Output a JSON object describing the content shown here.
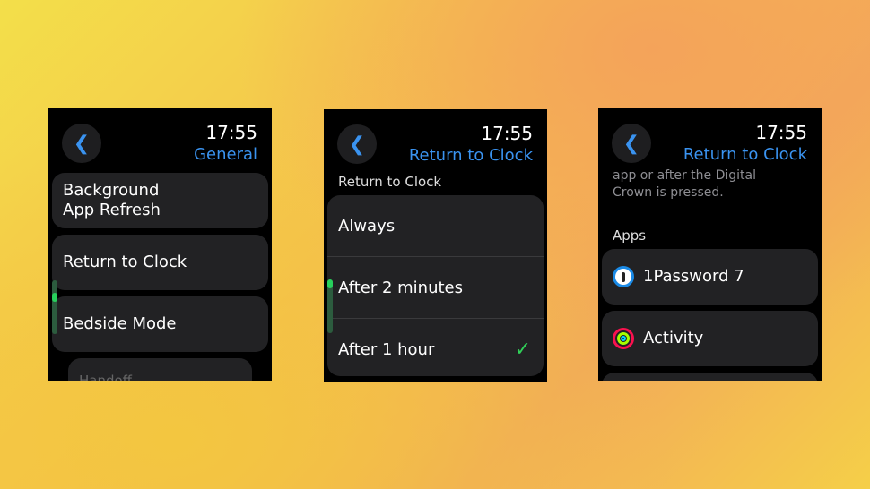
{
  "screens": [
    {
      "time": "17:55",
      "title": "General",
      "items": [
        "Background\nApp Refresh",
        "Return to Clock",
        "Bedside Mode",
        "Handoff"
      ]
    },
    {
      "time": "17:55",
      "title": "Return to Clock",
      "section": "Return to Clock",
      "options": [
        {
          "label": "Always",
          "selected": false
        },
        {
          "label": "After 2 minutes",
          "selected": false
        },
        {
          "label": "After 1 hour",
          "selected": true
        }
      ],
      "check_color": "#30d158"
    },
    {
      "time": "17:55",
      "title": "Return to Clock",
      "description": "app or after the Digital Crown is pressed.",
      "section": "Apps",
      "apps": [
        {
          "label": "1Password 7",
          "icon": "1password-icon"
        },
        {
          "label": "Activity",
          "icon": "activity-rings-icon"
        }
      ]
    }
  ],
  "accent": "#3a93f0"
}
